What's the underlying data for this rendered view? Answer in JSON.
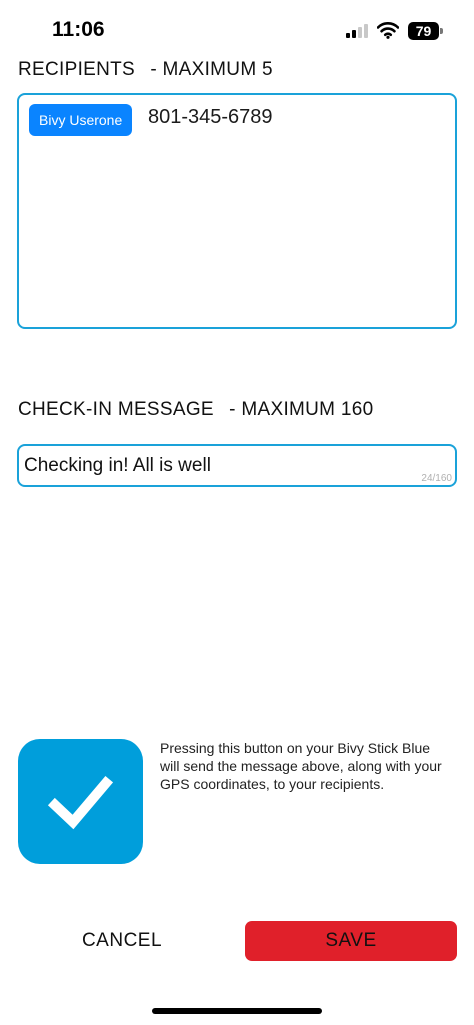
{
  "status_bar": {
    "time": "11:06",
    "battery_level": "79"
  },
  "recipients": {
    "label": "RECIPIENTS",
    "limit_label": "- MAXIMUM 5",
    "items": [
      {
        "chip_label": "Bivy Userone"
      }
    ],
    "phone_number": "801-345-6789"
  },
  "message": {
    "label": "CHECK-IN MESSAGE",
    "limit_label": "- MAXIMUM 160",
    "value": "Checking in! All is well",
    "char_count": "24/160"
  },
  "checkin_info": {
    "icon": "checkmark-icon",
    "description": "Pressing this button on your Bivy Stick Blue will send the message above, along with your GPS coordinates, to your recipients."
  },
  "actions": {
    "cancel_label": "CANCEL",
    "save_label": "SAVE"
  },
  "colors": {
    "accent": "#1aa2d9",
    "chip": "#0a84ff",
    "tile": "#009edb",
    "save": "#e0202a"
  }
}
